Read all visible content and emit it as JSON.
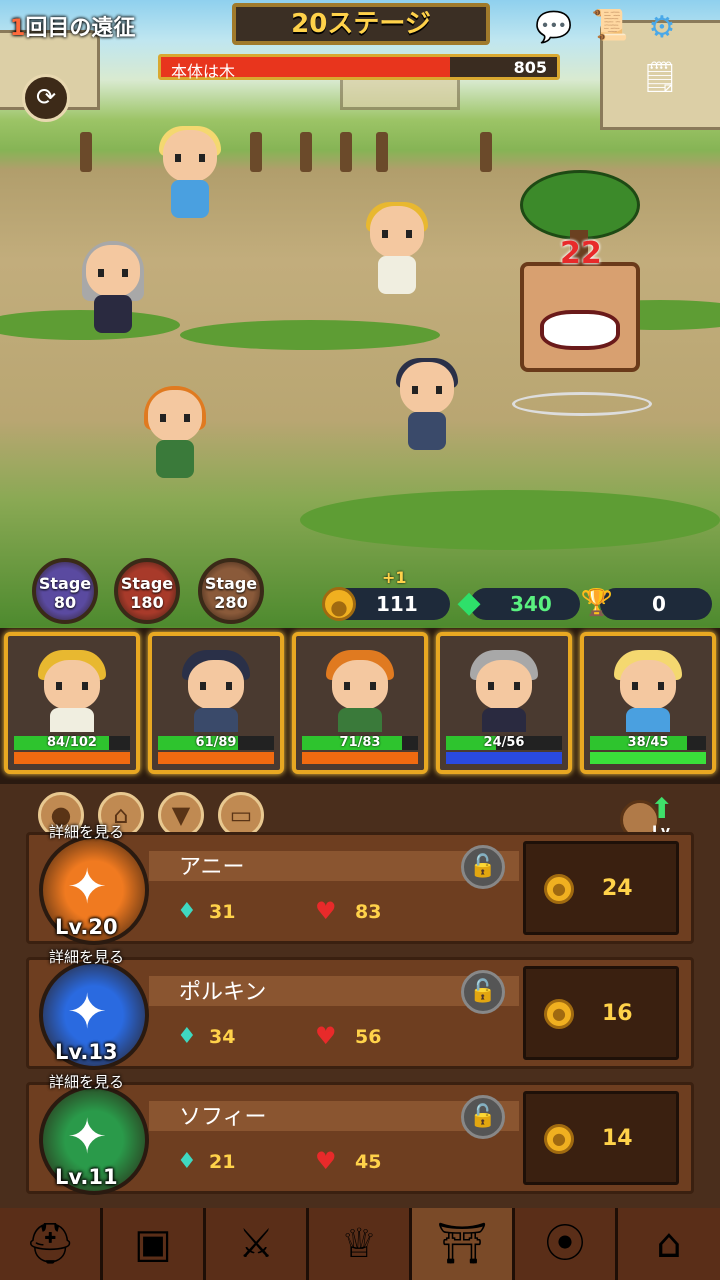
{
  "hud": {
    "expedition_num": "1",
    "expedition_text": "回目の遠征",
    "stage_title": "20ステージ",
    "boss_name": "本体は木",
    "boss_hp": "805",
    "boss_hp_fraction": 0.73
  },
  "damage_popup": "22",
  "medals": [
    {
      "label": "Stage",
      "value": "80",
      "color": "#5a4aa0"
    },
    {
      "label": "Stage",
      "value": "180",
      "color": "#a83a2a"
    },
    {
      "label": "Stage",
      "value": "280",
      "color": "#8a5a3a"
    }
  ],
  "currency": {
    "gold_plus": "+1",
    "gold": "111",
    "gems": "340",
    "trophies": "0"
  },
  "party": [
    {
      "hp": "84/102",
      "hp_fraction": 0.82,
      "role_color": "#f06a10",
      "hair": "#e8b830",
      "body": "#f0eee0"
    },
    {
      "hp": "61/89",
      "hp_fraction": 0.69,
      "role_color": "#f06a10",
      "hair": "#2a3048",
      "body": "#3a4a6a"
    },
    {
      "hp": "71/83",
      "hp_fraction": 0.86,
      "role_color": "#f06a10",
      "hair": "#e07a20",
      "body": "#3a7a3a"
    },
    {
      "hp": "24/56",
      "hp_fraction": 0.43,
      "role_color": "#2a4ae0",
      "hair": "#a8a8a8",
      "body": "#2a2a40"
    },
    {
      "hp": "38/45",
      "hp_fraction": 0.84,
      "role_color": "#3ae03a",
      "hair": "#f4d870",
      "body": "#4aa0e0"
    }
  ],
  "heroes": [
    {
      "detail": "詳細を見る",
      "name": "アニー",
      "level": "Lv.20",
      "attack": "31",
      "hp": "83",
      "cost": "24",
      "portrait_color": "#f07a20"
    },
    {
      "detail": "詳細を見る",
      "name": "ポルキン",
      "level": "Lv.13",
      "attack": "34",
      "hp": "56",
      "cost": "16",
      "portrait_color": "#2a6ae0"
    },
    {
      "detail": "詳細を見る",
      "name": "ソフィー",
      "level": "Lv.11",
      "attack": "21",
      "hp": "45",
      "cost": "14",
      "portrait_color": "#2a9a4a"
    }
  ],
  "panel_tabs": [
    "person-icon",
    "hanger-icon",
    "cat-icon",
    "book-icon"
  ],
  "nav": [
    "knight-helmet-icon",
    "armor-icon",
    "crossed-swords-icon",
    "winged-chalice-icon",
    "dungeon-door-icon",
    "collar-bone-icon",
    "shop-icon"
  ],
  "icons": {
    "expedition_num_color": "#ff6a3c",
    "accent_gold": "#ffd24a",
    "frame_gold": "#e8a822"
  }
}
